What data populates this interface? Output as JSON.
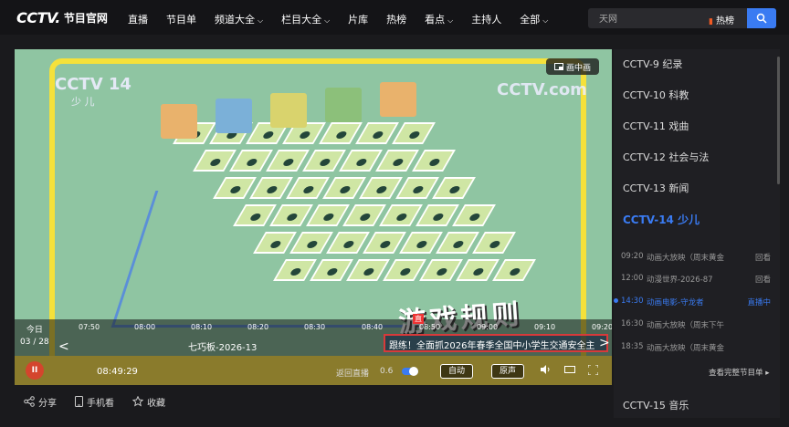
{
  "nav": {
    "logo": "CCTV.",
    "logo_text": "节目官网",
    "items": [
      {
        "label": "直播",
        "chevron": false
      },
      {
        "label": "节目单",
        "chevron": false
      },
      {
        "label": "频道大全",
        "chevron": true
      },
      {
        "label": "栏目大全",
        "chevron": true
      },
      {
        "label": "片库",
        "chevron": false
      },
      {
        "label": "热榜",
        "chevron": false
      },
      {
        "label": "看点",
        "chevron": true
      },
      {
        "label": "主持人",
        "chevron": false
      },
      {
        "label": "全部",
        "chevron": true
      }
    ],
    "search_value": "天网",
    "hot_label": "热榜"
  },
  "player": {
    "watermark_left": "CCTV 14",
    "watermark_left_sub": "少 儿",
    "watermark_right": "CCTV.com",
    "pip_label": "画中画",
    "today_label": "今日",
    "today_date": "03 / 28",
    "ticks": [
      "07:50",
      "08:00",
      "08:10",
      "08:20",
      "08:30",
      "08:40",
      "08:50",
      "09:00",
      "09:10",
      "09:20"
    ],
    "current_program": "七巧板-2026-13",
    "news_text": "跟练！全面抓2026年春季全国中小学生交通安全主",
    "big_text": "游戏规则",
    "live_flag": "直",
    "current_time": "08:49:29",
    "return_live": "返回直播",
    "speed_label": "0.6",
    "auto_label": "自动",
    "original_label": "原声"
  },
  "bottom": {
    "share": "分享",
    "mobile": "手机看",
    "favorite": "收藏"
  },
  "sidebar": {
    "channels": [
      {
        "label": "CCTV-9 纪录",
        "active": false
      },
      {
        "label": "CCTV-10 科教",
        "active": false
      },
      {
        "label": "CCTV-11 戏曲",
        "active": false
      },
      {
        "label": "CCTV-12 社会与法",
        "active": false
      },
      {
        "label": "CCTV-13 新闻",
        "active": false
      },
      {
        "label": "CCTV-14 少儿",
        "active": true
      }
    ],
    "schedule": [
      {
        "time": "09:20",
        "program": "动画大放映（周末黄金",
        "status": "回看",
        "current": false
      },
      {
        "time": "12:00",
        "program": "动漫世界-2026-87",
        "status": "回看",
        "current": false
      },
      {
        "time": "14:30",
        "program": "动画电影-守龙者",
        "status": "直播中",
        "current": true
      },
      {
        "time": "16:30",
        "program": "动画大放映（周末下午",
        "status": "",
        "current": false
      },
      {
        "time": "18:35",
        "program": "动画大放映（周末黄金",
        "status": "",
        "current": false
      }
    ],
    "more_label": "查看完整节目单 ▸",
    "next_channel": "CCTV-15 音乐"
  }
}
